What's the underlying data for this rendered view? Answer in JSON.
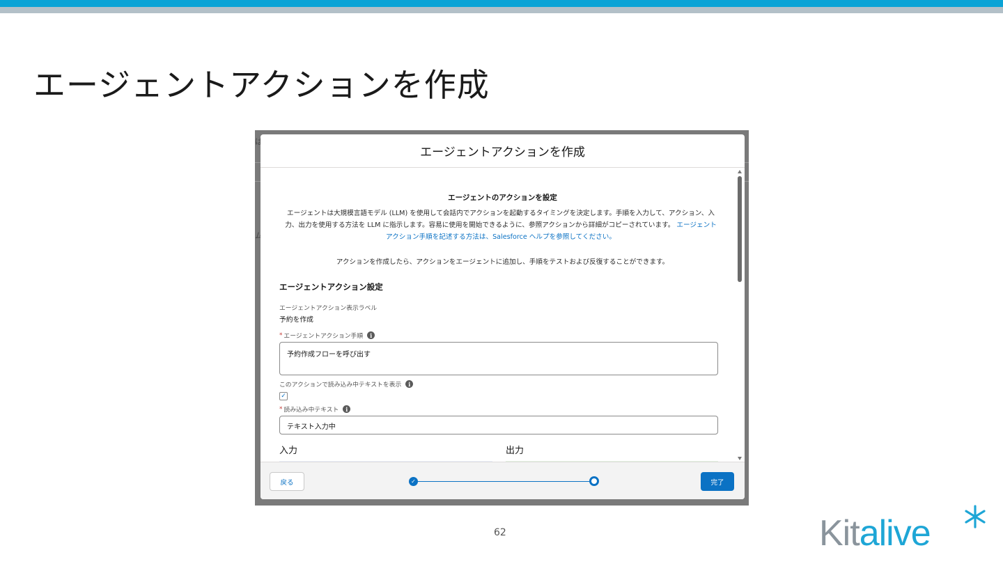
{
  "slide": {
    "title": "エージェントアクションを作成",
    "page_number": "62",
    "logo": {
      "part1": "Kit",
      "part2": "alive",
      "brand_blue": "#1ea6d6",
      "brand_grey": "#8a949c"
    },
    "bar_colors": {
      "blue": "#0aa3d6",
      "grey": "#b3c0c8"
    }
  },
  "modal": {
    "header_title": "エージェントアクションを作成",
    "section_heading": "エージェントのアクションを設定",
    "intro_text": "エージェントは大規模言語モデル (LLM) を使用して会話内でアクションを起動するタイミングを決定します。手順を入力して、アクション、入力、出力を使用する方法を LLM に指示します。容易に使用を開始できるように、参照アクションから詳細がコピーされています。",
    "intro_link": "エージェントアクション手順を記述する方法は、Salesforce ヘルプを参照してください。",
    "intro_text2": "アクションを作成したら、アクションをエージェントに追加し、手順をテストおよび反復することができます。",
    "settings_heading": "エージェントアクション設定",
    "display_label_label": "エージェントアクション表示ラベル",
    "display_label_value": "予約を作成",
    "instructions_label": "エージェントアクション手順",
    "instructions_value": "予約作成フローを呼び出す",
    "show_loading_label": "このアクションで読み込み中テキストを表示",
    "show_loading_checked": true,
    "loading_text_label": "読み込み中テキスト",
    "loading_text_value": "テキスト入力中",
    "input_heading": "入力",
    "output_heading": "出力",
    "back_label": "戻る",
    "done_label": "完了",
    "accent_color": "#0b72c4"
  }
}
